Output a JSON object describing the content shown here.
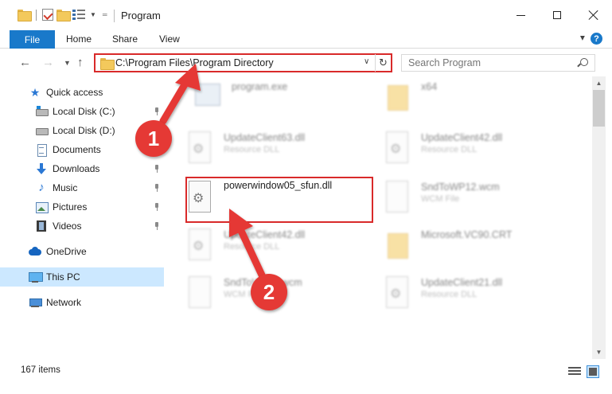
{
  "window": {
    "title": "Program"
  },
  "ribbon": {
    "tabs": [
      "File",
      "Home",
      "Share",
      "View"
    ],
    "help": "?"
  },
  "nav": {
    "address": "C:\\Program Files\\Program Directory",
    "search_placeholder": "Search Program"
  },
  "sidebar": {
    "items": [
      {
        "label": "Quick access",
        "icon": "star-icon",
        "pinned": false
      },
      {
        "label": "Local Disk (C:)",
        "icon": "disk-icon",
        "pinned": true
      },
      {
        "label": "Local Disk (D:)",
        "icon": "disk-icon",
        "pinned": false
      },
      {
        "label": "Documents",
        "icon": "documents-icon",
        "pinned": true
      },
      {
        "label": "Downloads",
        "icon": "downloads-icon",
        "pinned": true
      },
      {
        "label": "Music",
        "icon": "music-icon",
        "pinned": true
      },
      {
        "label": "Pictures",
        "icon": "pictures-icon",
        "pinned": true
      },
      {
        "label": "Videos",
        "icon": "videos-icon",
        "pinned": true
      },
      {
        "label": "OneDrive",
        "icon": "cloud-icon",
        "pinned": false
      },
      {
        "label": "This PC",
        "icon": "computer-icon",
        "pinned": false,
        "selected": true
      },
      {
        "label": "Network",
        "icon": "network-icon",
        "pinned": false
      }
    ]
  },
  "files": [
    {
      "name": "program.exe",
      "type": "",
      "icon": "exe-icon",
      "blurred": true
    },
    {
      "name": "x64",
      "type": "",
      "icon": "folder-icon",
      "blurred": true
    },
    {
      "name": "UpdateClient63.dll",
      "type": "Resource DLL",
      "icon": "dll-icon",
      "blurred": true
    },
    {
      "name": "UpdateClient42.dll",
      "type": "Resource DLL",
      "icon": "dll-icon",
      "blurred": true
    },
    {
      "name": "powerwindow05_sfun.dll",
      "type": "",
      "icon": "dll-icon",
      "blurred": false,
      "highlighted": true
    },
    {
      "name": "SndToWP12.wcm",
      "type": "WCM File",
      "icon": "file-icon",
      "blurred": true
    },
    {
      "name": "UpdateClient42.dll",
      "type": "Resource DLL",
      "icon": "dll-icon",
      "blurred": true
    },
    {
      "name": "Microsoft.VC90.CRT",
      "type": "",
      "icon": "folder-icon",
      "blurred": true
    },
    {
      "name": "SndToWP26.wcm",
      "type": "WCM File",
      "icon": "file-icon",
      "blurred": true
    },
    {
      "name": "UpdateClient21.dll",
      "type": "Resource DLL",
      "icon": "dll-icon",
      "blurred": true
    }
  ],
  "status": {
    "item_count": "167 items"
  },
  "annotations": {
    "step1": "1",
    "step2": "2",
    "color": "#e53935"
  }
}
